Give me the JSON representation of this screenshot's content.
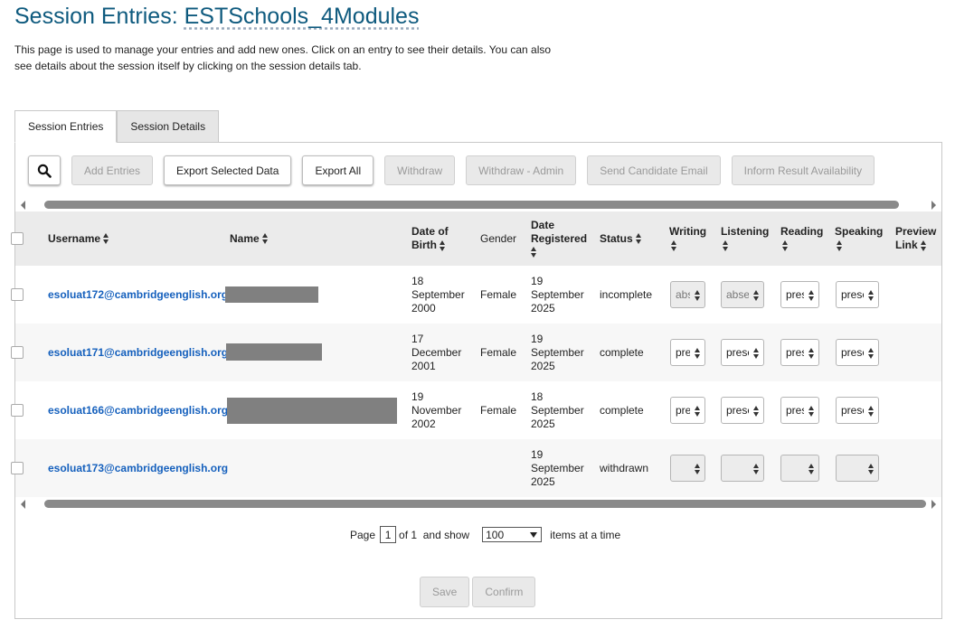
{
  "header": {
    "title_prefix": "Session Entries: ",
    "session_name": "ESTSchools_4Modules",
    "intro": "This page is used to manage your entries and add new ones. Click on an entry to see their details. You can also see details about the session itself by clicking on the session details tab."
  },
  "tabs": [
    {
      "label": "Session Entries",
      "active": true
    },
    {
      "label": "Session Details",
      "active": false
    }
  ],
  "toolbar": {
    "search_icon": "search-icon",
    "add_entries": "Add Entries",
    "export_selected": "Export Selected Data",
    "export_all": "Export All",
    "withdraw": "Withdraw",
    "withdraw_admin": "Withdraw - Admin",
    "send_email": "Send Candidate Email",
    "inform_result": "Inform Result Availability"
  },
  "columns": {
    "username": "Username",
    "name": "Name",
    "dob": "Date of Birth",
    "gender": "Gender",
    "registered": "Date Registered",
    "status": "Status",
    "writing": "Writing",
    "listening": "Listening",
    "reading": "Reading",
    "speaking": "Speaking",
    "preview": "Preview Link"
  },
  "rows": [
    {
      "username": "esoluat172@cambridgeenglish.org",
      "dob": "18 September 2000",
      "gender": "Female",
      "registered": "19 September 2025",
      "status": "incomplete",
      "writing": "absent",
      "listening": "absent",
      "reading": "present",
      "speaking": "present"
    },
    {
      "username": "esoluat171@cambridgeenglish.org",
      "dob": "17 December 2001",
      "gender": "Female",
      "registered": "19 September 2025",
      "status": "complete",
      "writing": "present",
      "listening": "present",
      "reading": "present",
      "speaking": "present"
    },
    {
      "username": "esoluat166@cambridgeenglish.org",
      "dob": "19 November 2002",
      "gender": "Female",
      "registered": "18 September 2025",
      "status": "complete",
      "writing": "present",
      "listening": "present",
      "reading": "present",
      "speaking": "present"
    },
    {
      "username": "esoluat173@cambridgeenglish.org",
      "dob": "",
      "gender": "",
      "registered": "19 September 2025",
      "status": "withdrawn",
      "writing": "",
      "listening": "",
      "reading": "",
      "speaking": ""
    }
  ],
  "pager": {
    "page_label": "Page",
    "page_value": "1",
    "of_label": "of 1  and show",
    "page_size": "100",
    "items_label": "items at a time"
  },
  "footer": {
    "save": "Save",
    "confirm": "Confirm"
  },
  "colors": {
    "title": "#0e5a7e",
    "link": "#1560bd",
    "redaction": "#808080"
  }
}
